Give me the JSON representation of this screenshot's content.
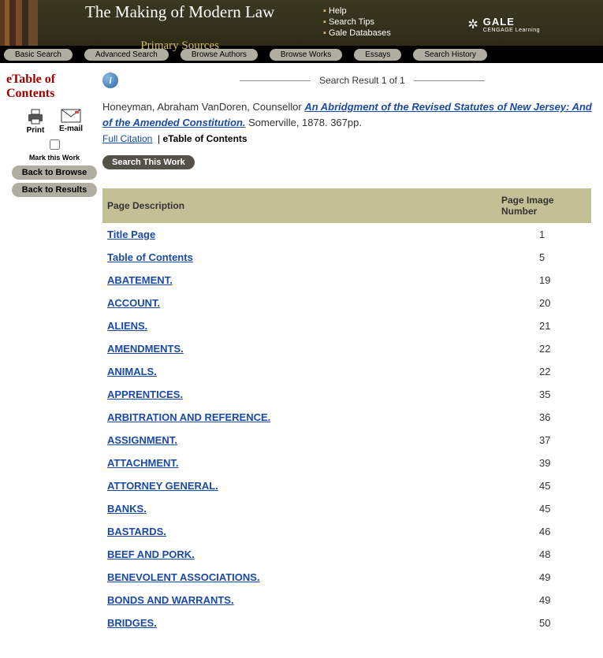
{
  "banner": {
    "title_main": "The Making of Modern Law",
    "title_sub": "Primary Sources",
    "help_links": [
      "Help",
      "Search Tips",
      "Gale Databases"
    ],
    "logo_brand": "GALE",
    "logo_sub": "CENGAGE Learning"
  },
  "nav": [
    "Basic Search",
    "Advanced Search",
    "Browse Authors",
    "Browse Works",
    "Essays",
    "Search History"
  ],
  "sidebar": {
    "title": "eTable of Contents",
    "print_label": "Print",
    "email_label": "E-mail",
    "mark_label": "Mark this Work",
    "back_browse": "Back to Browse",
    "back_results": "Back to Results"
  },
  "result": {
    "text": "Search Result 1 of 1"
  },
  "citation": {
    "author": "Honeyman, Abraham VanDoren, Counsellor",
    "work_title": "An Abridgment of the Revised Statutes of New Jersey: And of the Amended Constitution.",
    "pub_place": "Somerville",
    "pub_year": "1878",
    "pp": "367pp.",
    "full_citation_label": "Full Citation",
    "etoc_label": "eTable of Contents",
    "search_this_work": "Search This Work"
  },
  "toc": {
    "col1": "Page Description",
    "col2": "Page Image Number",
    "rows": [
      {
        "desc": "Title Page",
        "page": "1"
      },
      {
        "desc": "Table of Contents",
        "page": "5"
      },
      {
        "desc": "ABATEMENT.",
        "page": "19"
      },
      {
        "desc": "ACCOUNT.",
        "page": "20"
      },
      {
        "desc": "ALIENS.",
        "page": "21"
      },
      {
        "desc": "AMENDMENTS.",
        "page": "22"
      },
      {
        "desc": "ANIMALS.",
        "page": "22"
      },
      {
        "desc": "APPRENTICES.",
        "page": "35"
      },
      {
        "desc": "ARBITRATION AND REFERENCE.",
        "page": "36"
      },
      {
        "desc": "ASSIGNMENT.",
        "page": "37"
      },
      {
        "desc": "ATTACHMENT.",
        "page": "39"
      },
      {
        "desc": "ATTORNEY GENERAL.",
        "page": "45"
      },
      {
        "desc": "BANKS.",
        "page": "45"
      },
      {
        "desc": "BASTARDS.",
        "page": "46"
      },
      {
        "desc": "BEEF AND PORK.",
        "page": "48"
      },
      {
        "desc": "BENEVOLENT ASSOCIATIONS.",
        "page": "49"
      },
      {
        "desc": "BONDS AND WARRANTS.",
        "page": "49"
      },
      {
        "desc": "BRIDGES.",
        "page": "50"
      }
    ]
  }
}
